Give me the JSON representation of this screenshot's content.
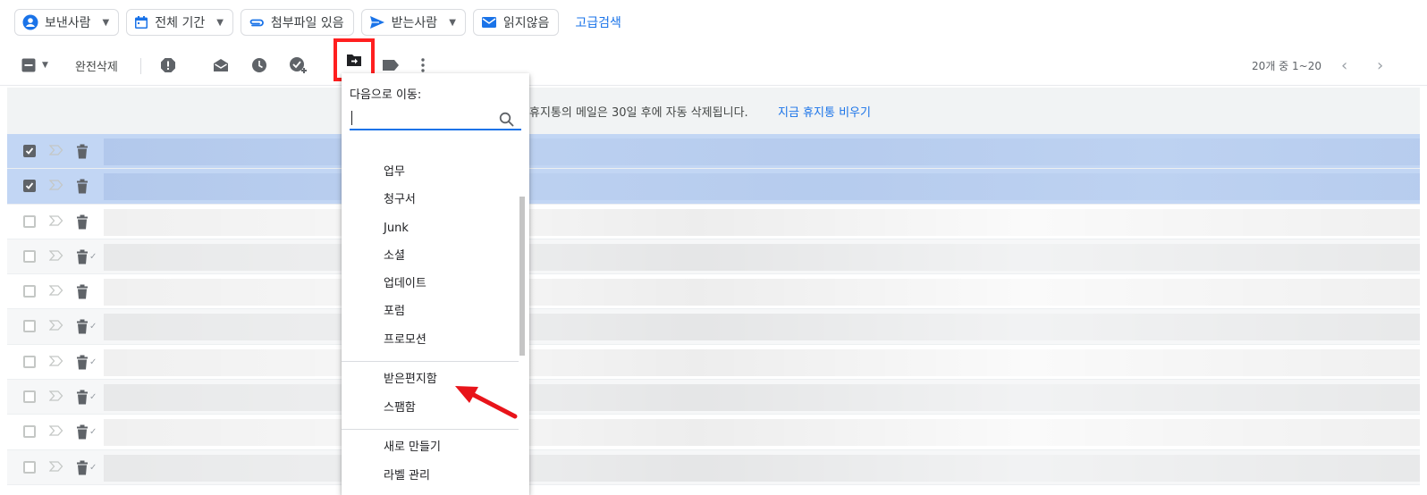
{
  "filters": {
    "sender": "보낸사람",
    "period": "전체 기간",
    "attachment": "첨부파일 있음",
    "recipient": "받는사람",
    "unread": "읽지않음",
    "advanced": "고급검색"
  },
  "toolbar": {
    "delete_forever": "완전삭제",
    "pagination": "20개 중 1~20"
  },
  "banner": {
    "message": "휴지통의 메일은 30일 후에 자동 삭제됩니다.",
    "empty_link": "지금 휴지통 비우기"
  },
  "move_menu": {
    "title": "다음으로 이동:",
    "search_placeholder": "",
    "items": [
      "업무",
      "청구서",
      "Junk",
      "소셜",
      "업데이트",
      "포럼",
      "프로모션"
    ],
    "system_items": [
      "받은편지함",
      "스팸함"
    ],
    "actions": [
      "새로 만들기",
      "라벨 관리"
    ]
  },
  "rows": [
    {
      "selected": true,
      "read_receipt": false
    },
    {
      "selected": true,
      "read_receipt": false
    },
    {
      "selected": false,
      "read_receipt": false
    },
    {
      "selected": false,
      "read_receipt": true
    },
    {
      "selected": false,
      "read_receipt": false
    },
    {
      "selected": false,
      "read_receipt": true
    },
    {
      "selected": false,
      "read_receipt": true
    },
    {
      "selected": false,
      "read_receipt": true
    },
    {
      "selected": false,
      "read_receipt": true
    },
    {
      "selected": false,
      "read_receipt": true
    }
  ],
  "colors": {
    "accent": "#1a73e8",
    "highlight_box": "#ff1f1f",
    "selected_row": "#c2d6f4"
  },
  "icons": [
    "person-icon",
    "calendar-icon",
    "paperclip-icon",
    "send-icon",
    "mail-icon",
    "select-all-checkbox-icon",
    "report-spam-icon",
    "mark-unread-icon",
    "snooze-icon",
    "add-task-icon",
    "move-to-folder-icon",
    "label-icon",
    "more-icon",
    "chevron-left-icon",
    "chevron-right-icon",
    "search-icon",
    "trash-icon",
    "important-marker-icon"
  ]
}
